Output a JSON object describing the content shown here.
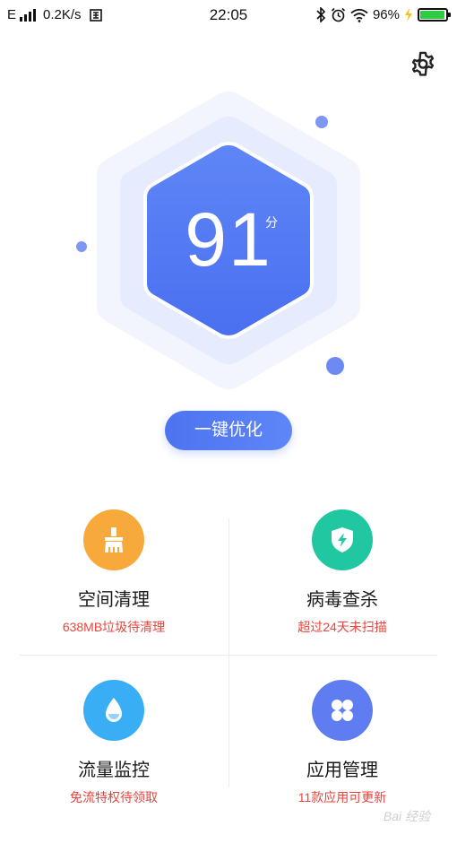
{
  "status_bar": {
    "network": "E",
    "speed": "0.2K/s",
    "time": "22:05",
    "battery": "96%",
    "battery_level": 0.96,
    "battery_color": "#2ecc40"
  },
  "settings": {
    "icon": "gear-icon"
  },
  "score": {
    "value": "91",
    "unit": "分"
  },
  "optimize_button": {
    "label": "一键优化",
    "color": "#4d73f0"
  },
  "tiles": [
    {
      "title": "空间清理",
      "subtitle": "638MB垃圾待清理",
      "icon": "broom-icon",
      "color": "#f7a93b"
    },
    {
      "title": "病毒查杀",
      "subtitle": "超过24天未扫描",
      "icon": "shield-icon",
      "color": "#21c7a0"
    },
    {
      "title": "流量监控",
      "subtitle": "免流特权待领取",
      "icon": "droplet-icon",
      "color": "#3aaef5"
    },
    {
      "title": "应用管理",
      "subtitle": "11款应用可更新",
      "icon": "apps-grid-icon",
      "color": "#5f7cf0"
    }
  ],
  "watermark": "Bai 经验"
}
